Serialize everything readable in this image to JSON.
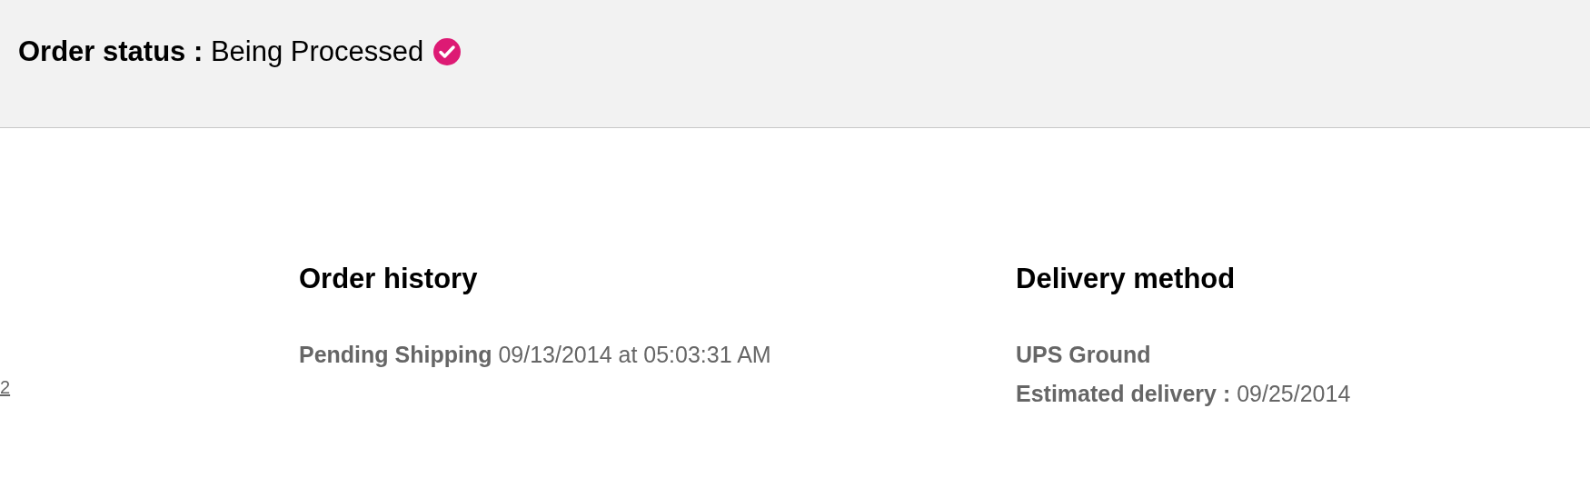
{
  "order_status": {
    "label": "Order status :",
    "value": "Being Processed",
    "confirmed": true
  },
  "left_column": {
    "link": "2"
  },
  "order_history": {
    "title": "Order history",
    "entries": [
      {
        "status": "Pending Shipping",
        "date": "09/13/2014 at 05:03:31 AM"
      }
    ]
  },
  "delivery_method": {
    "title": "Delivery method",
    "carrier": "UPS Ground",
    "estimate_label": "Estimated delivery :",
    "estimate_date": "09/25/2014"
  }
}
